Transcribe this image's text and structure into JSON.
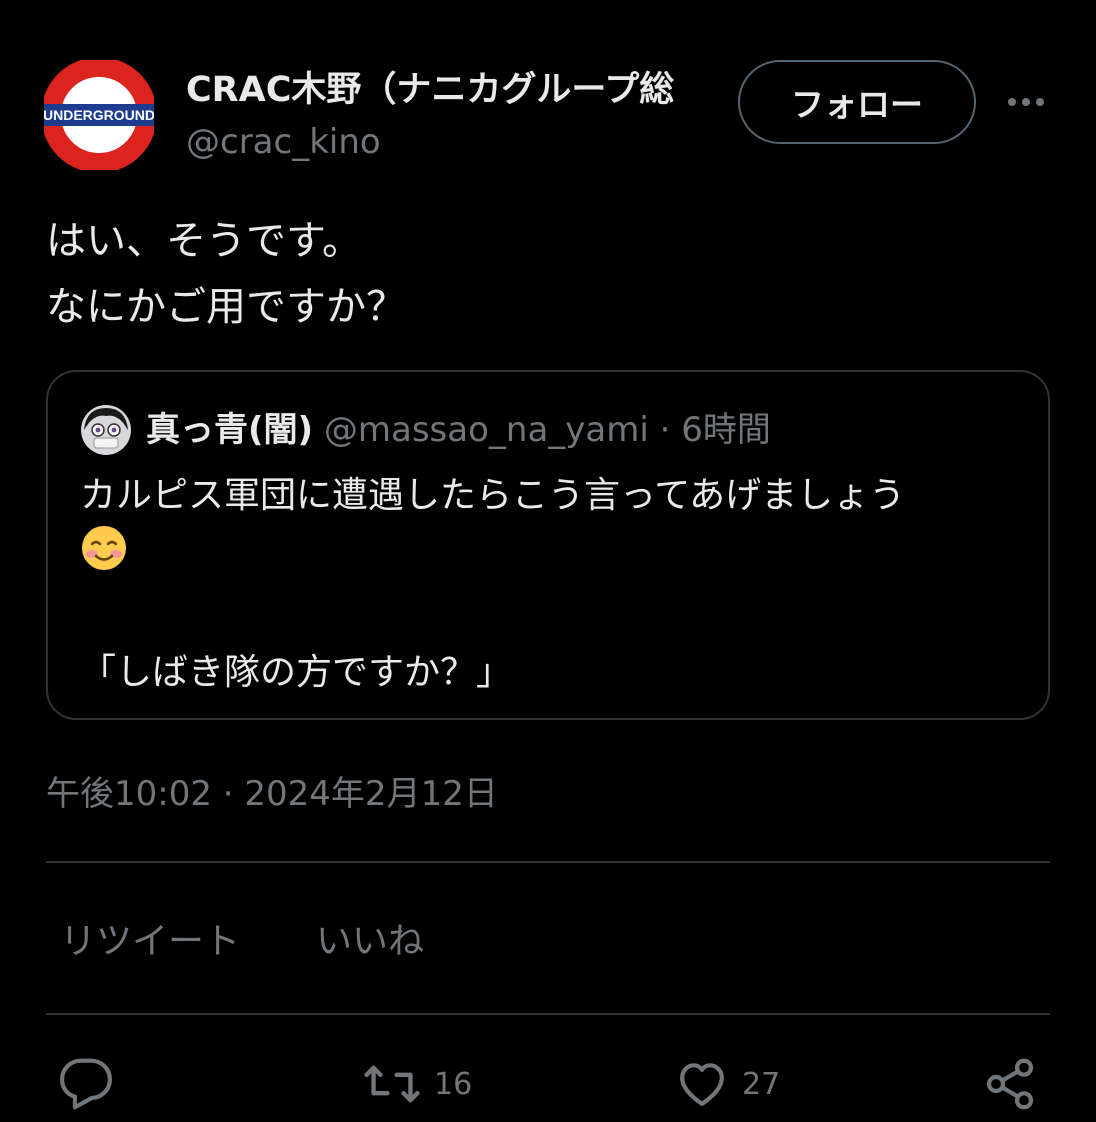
{
  "header": {
    "display_name": "CRAC木野（ナニカグループ総",
    "handle": "@crac_kino",
    "avatar_text": "UNDERGROUND",
    "follow_label": "フォロー"
  },
  "tweet": {
    "lines": [
      "はい、そうです。",
      "なにかご用ですか？"
    ]
  },
  "quote": {
    "name": "真っ青(闇)",
    "handle": "@massao_na_yami",
    "separator": "·",
    "time": "6時間",
    "line1": "カルピス軍団に遭遇したらこう言ってあげましょう",
    "line3": "「しばき隊の方ですか？」"
  },
  "timestamp": "午後10:02 · 2024年2月12日",
  "stats": {
    "retweets_label": "リツイート",
    "likes_label": "いいね"
  },
  "actions": {
    "retweet_count": "16",
    "like_count": "27"
  },
  "colors": {
    "background": "#000000",
    "text": "#e7e9ea",
    "muted": "#71767b",
    "border": "#2f3336",
    "avatar_red": "#dc241f",
    "avatar_blue": "#1d3c8f"
  }
}
